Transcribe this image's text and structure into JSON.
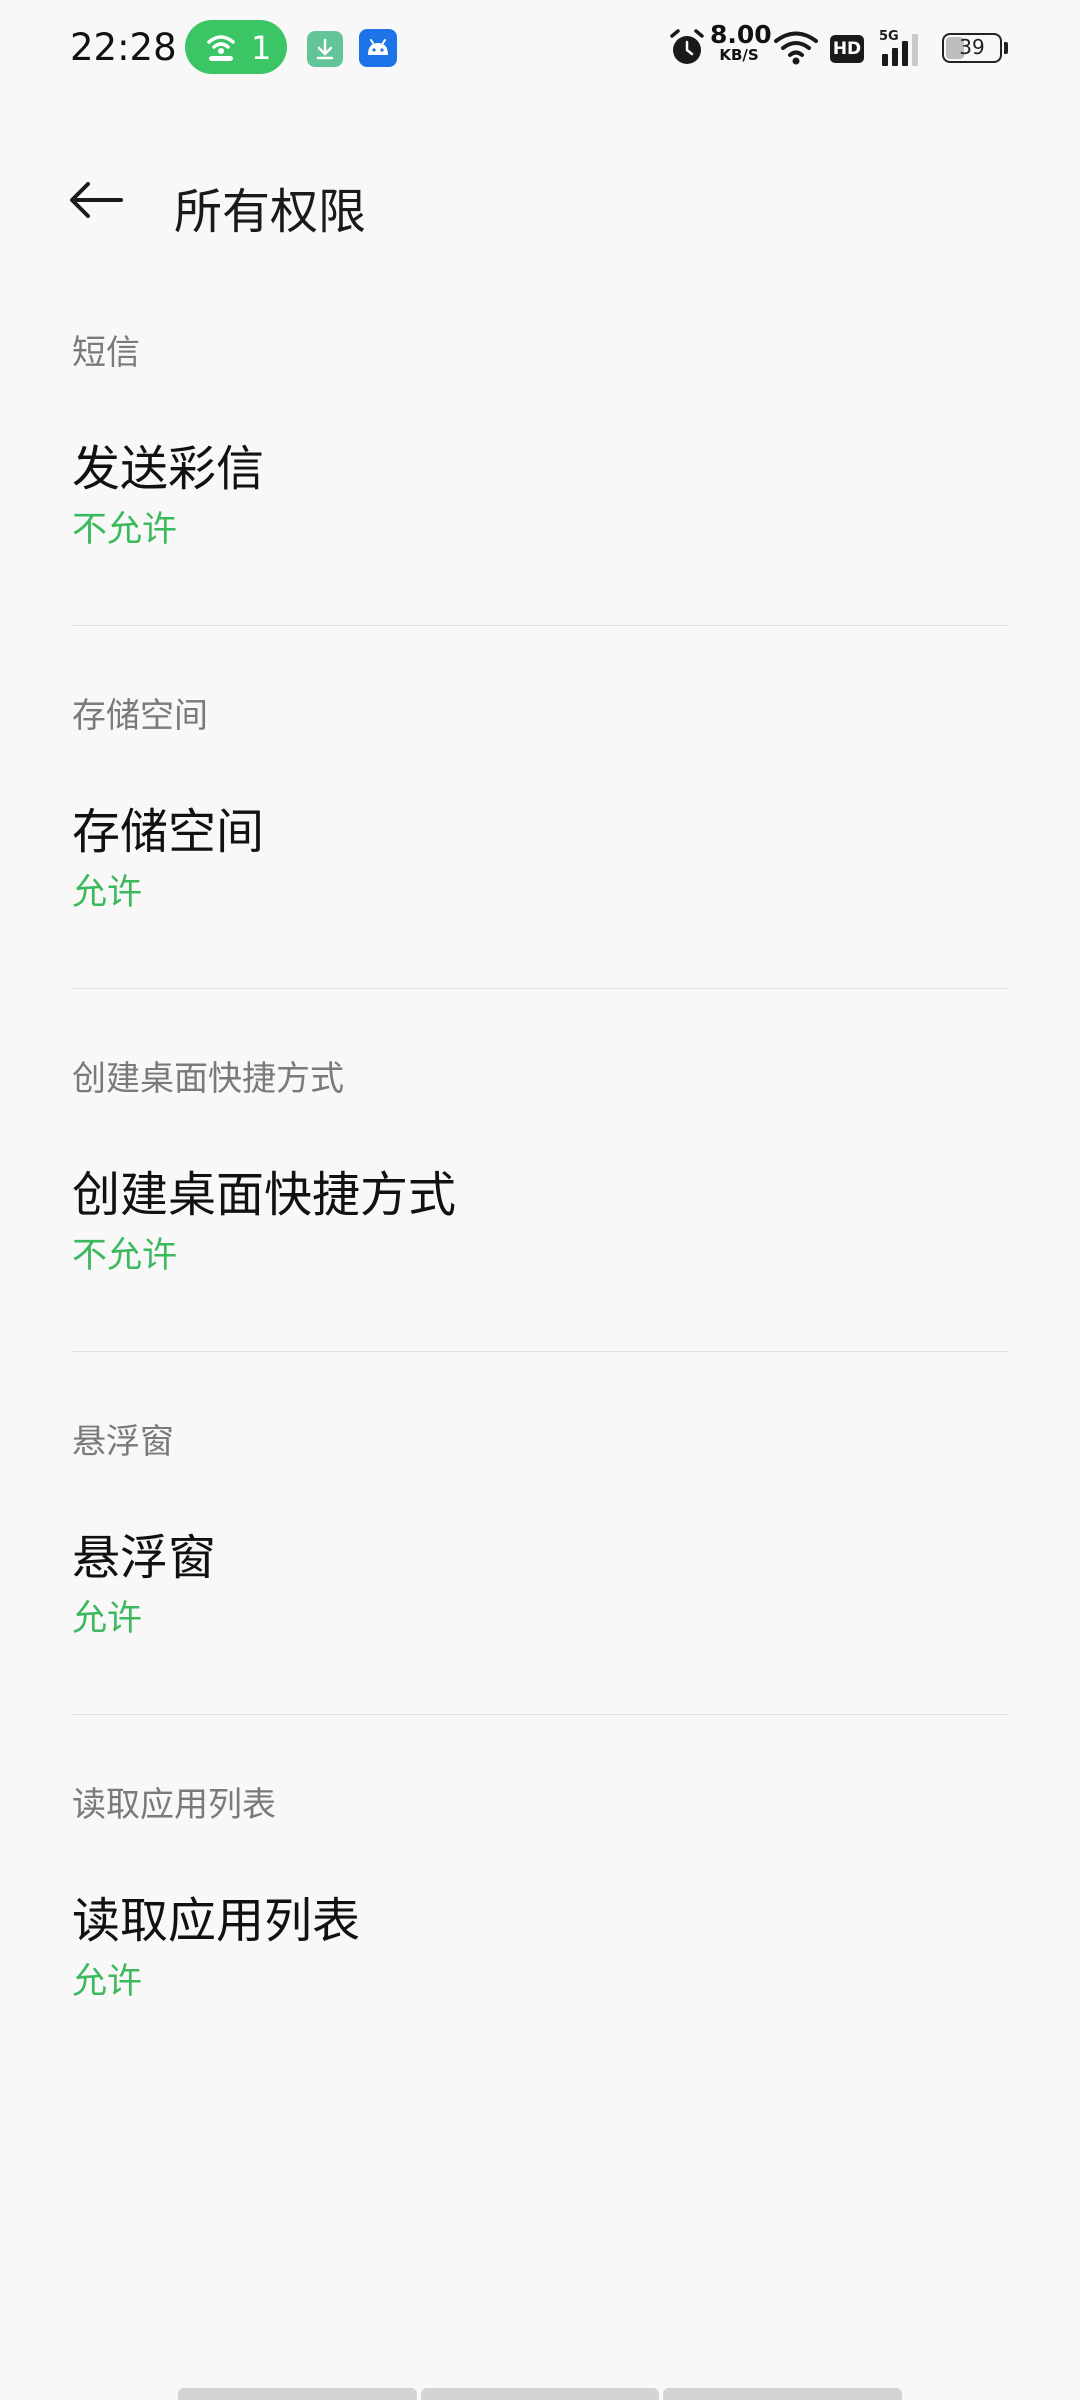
{
  "status_bar": {
    "time": "22:28",
    "hotspot_count": "1",
    "net_speed_value": "8.00",
    "net_speed_unit": "KB/S",
    "hd_label": "HD",
    "network_label": "5G",
    "battery_level": "39",
    "icons": [
      "hotspot-icon",
      "download-icon",
      "android-icon",
      "alarm-icon",
      "wifi-icon",
      "signal-icon"
    ]
  },
  "header": {
    "back_icon": "arrow-left-icon",
    "title": "所有权限"
  },
  "sections": [
    {
      "header": "短信",
      "title": "发送彩信",
      "status": "不允许"
    },
    {
      "header": "存储空间",
      "title": "存储空间",
      "status": "允许"
    },
    {
      "header": "创建桌面快捷方式",
      "title": "创建桌面快捷方式",
      "status": "不允许"
    },
    {
      "header": "悬浮窗",
      "title": "悬浮窗",
      "status": "允许"
    },
    {
      "header": "读取应用列表",
      "title": "读取应用列表",
      "status": "允许"
    }
  ],
  "colors": {
    "background": "#f8f8f8",
    "status_green": "#3cb95d",
    "hotspot_green": "#3bc564",
    "section_header_gray": "#7a7a7a",
    "divider": "#e3e3e3"
  }
}
